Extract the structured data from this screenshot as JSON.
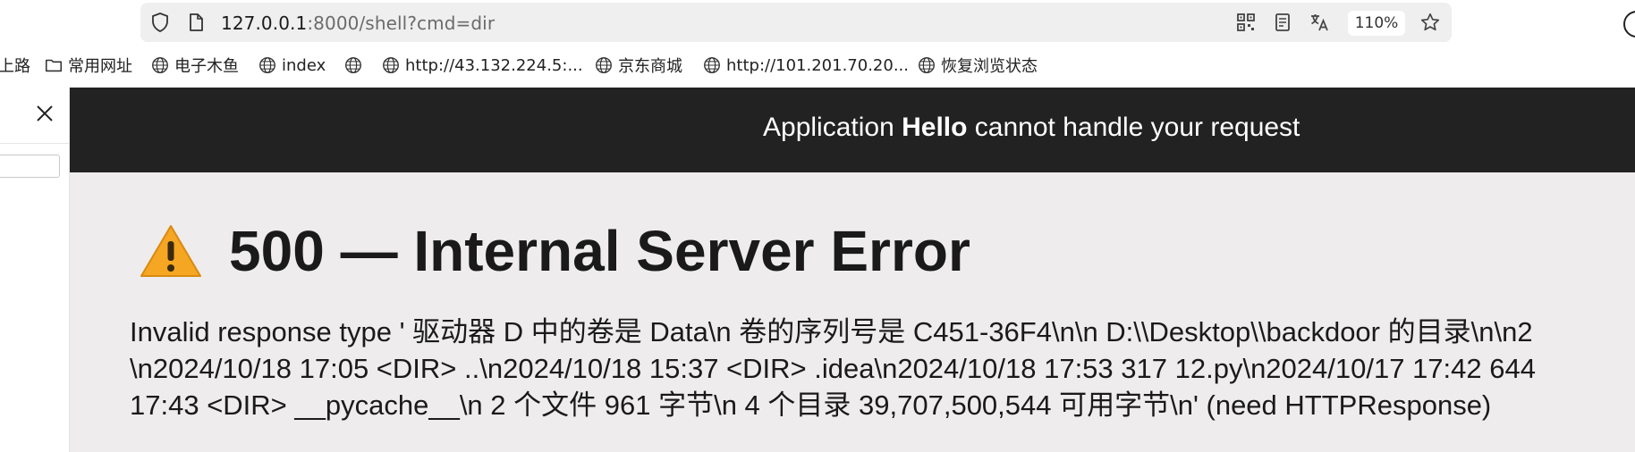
{
  "browser": {
    "url_host": "127.0.0.1",
    "url_rest": ":8000/shell?cmd=dir",
    "zoom": "110%"
  },
  "bookmarks": [
    {
      "label": "上路",
      "icon": "none"
    },
    {
      "label": "常用网址",
      "icon": "folder-icon"
    },
    {
      "label": "电子木鱼",
      "icon": "globe-icon"
    },
    {
      "label": "index",
      "icon": "globe-icon"
    },
    {
      "label": "",
      "icon": "globe-icon"
    },
    {
      "label": "http://43.132.224.5:...",
      "icon": "globe-icon"
    },
    {
      "label": "京东商城",
      "icon": "globe-icon"
    },
    {
      "label": "http://101.201.70.20...",
      "icon": "globe-icon"
    },
    {
      "label": "恢复浏览状态",
      "icon": "globe-icon"
    }
  ],
  "page": {
    "header_prefix": "Application ",
    "header_app": "Hello",
    "header_suffix": " cannot handle your request",
    "error_title": "500 — Internal Server Error",
    "error_lines": [
      "Invalid response type ' 驱动器 D 中的卷是 Data\\n 卷的序列号是 C451-36F4\\n\\n D:\\\\Desktop\\\\backdoor 的目录\\n\\n2",
      "\\n2024/10/18 17:05 <DIR> ..\\n2024/10/18 15:37 <DIR> .idea\\n2024/10/18 17:53 317 12.py\\n2024/10/17 17:42 644",
      "17:43 <DIR> __pycache__\\n 2 个文件 961 字节\\n 4 个目录 39,707,500,544 可用字节\\n' (need HTTPResponse)"
    ]
  },
  "colors": {
    "header_bg": "#222222",
    "page_bg": "#eeecec",
    "urlbar_bg": "#efefef"
  }
}
